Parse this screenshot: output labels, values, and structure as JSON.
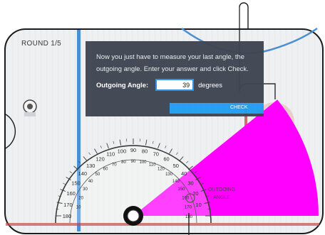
{
  "round": {
    "label": "ROUND 1/5"
  },
  "dialog": {
    "instruction": "Now you just have to measure your last angle, the outgoing angle. Enter your answer and click Check.",
    "field_label": "Outgoing Angle:",
    "answer_value": "39",
    "units": "degrees",
    "check_label": "CHECK"
  },
  "protractor": {
    "tick_labels": [
      "10",
      "20",
      "30",
      "40",
      "50",
      "60",
      "70",
      "80",
      "90",
      "100",
      "110",
      "120",
      "130",
      "140",
      "150",
      "160",
      "170",
      "180"
    ],
    "inner_labels": [
      "10",
      "20",
      "30",
      "40",
      "50",
      "60",
      "70",
      "80",
      "90",
      "100",
      "110",
      "120",
      "130",
      "140",
      "150",
      "160",
      "170",
      "180"
    ]
  },
  "overlay": {
    "angle_label": "OUTGOING ANGLE"
  },
  "colors": {
    "angle_fill": "#ff00ff",
    "dialog_bg": "#3e4551",
    "check_button": "#1f9ef0",
    "input_border": "#2f8fe0",
    "rink_blue_line": "#4a8ed4",
    "rink_red_line": "#c44c4c"
  },
  "angle": {
    "measured_degrees": 39
  }
}
